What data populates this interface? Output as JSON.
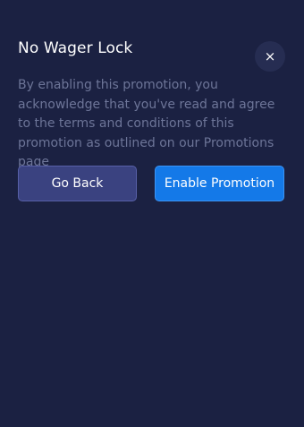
{
  "modal": {
    "title": "No Wager Lock",
    "close_glyph": "×",
    "body": "By enabling this promotion, you acknowledge that you've read and agree to the terms and conditions of this promotion as outlined on our Promotions page",
    "buttons": {
      "back_label": "Go Back",
      "enable_label": "Enable Promotion"
    }
  },
  "colors": {
    "background": "#1b2142",
    "primary": "#1479e8",
    "secondary": "#3a4280",
    "muted_text": "#6d7598"
  },
  "icons": {
    "close": "close-icon"
  }
}
